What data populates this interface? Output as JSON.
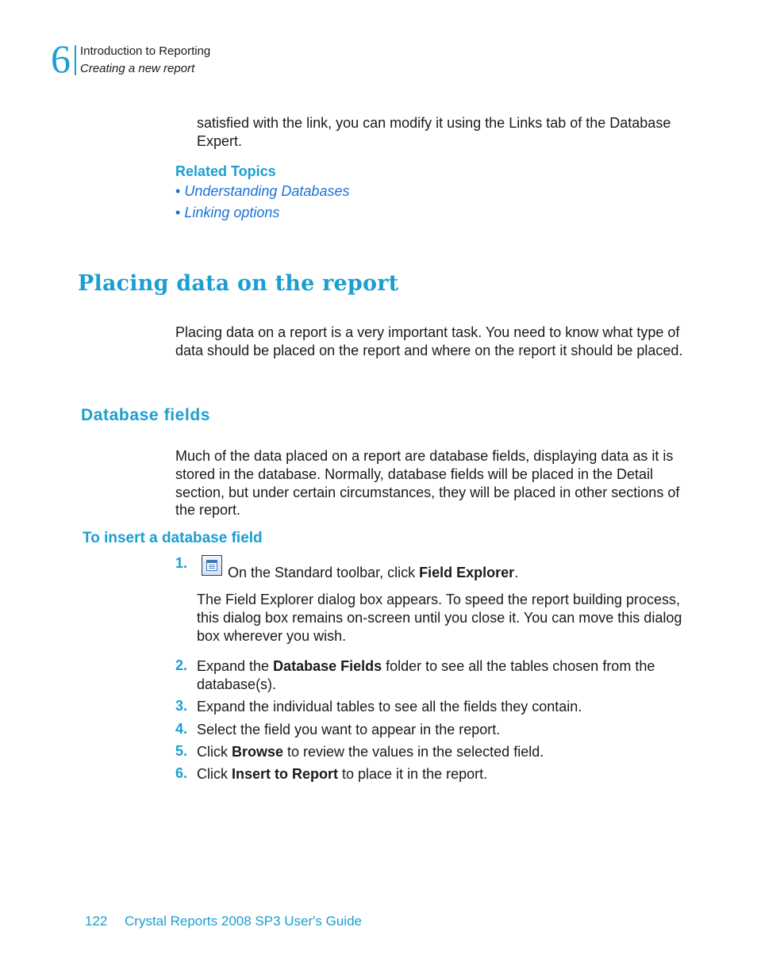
{
  "header": {
    "chapter_number": "6",
    "chapter_title": "Introduction to Reporting",
    "section_title": "Creating a new report"
  },
  "continuation_paragraph": "satisfied with the link, you can modify it using the Links tab of the Database Expert.",
  "related_topics": {
    "heading": "Related Topics",
    "bullet": "•",
    "links": [
      "Understanding Databases",
      "Linking options"
    ]
  },
  "section": {
    "heading": "Placing data on the report",
    "intro": "Placing data on a report is a very important task. You need to know what type of data should be placed on the report and where on the report it should be placed.",
    "subsection": {
      "heading": "Database fields",
      "paragraph": "Much of the data placed on a report are database fields, displaying data as it is stored in the database. Normally, database fields will be placed in the Detail section, but under certain circumstances, they will be placed in other sections of the report.",
      "procedure": {
        "heading": "To insert a database field",
        "steps": [
          {
            "num": "1.",
            "before": "On the Standard toolbar, click ",
            "bold": "Field Explorer",
            "after": ".",
            "icon": "field-explorer-icon",
            "note": "The Field Explorer dialog box appears. To speed the report building process, this dialog box remains on-screen until you close it. You can move this dialog box wherever you wish."
          },
          {
            "num": "2.",
            "before": "Expand the ",
            "bold": "Database Fields",
            "after": " folder to see all the tables chosen from the database(s)."
          },
          {
            "num": "3.",
            "before": "Expand the individual tables to see all the fields they contain.",
            "bold": "",
            "after": ""
          },
          {
            "num": "4.",
            "before": "Select the field you want to appear in the report.",
            "bold": "",
            "after": ""
          },
          {
            "num": "5.",
            "before": "Click ",
            "bold": "Browse",
            "after": " to review the values in the selected field."
          },
          {
            "num": "6.",
            "before": "Click ",
            "bold": "Insert to Report",
            "after": " to place it in the report."
          }
        ]
      }
    }
  },
  "footer": {
    "page_number": "122",
    "book_title": "Crystal Reports 2008 SP3 User's Guide"
  },
  "colors": {
    "accent": "#1a9fd0",
    "link": "#1a73d9",
    "text": "#1a1a1a"
  }
}
